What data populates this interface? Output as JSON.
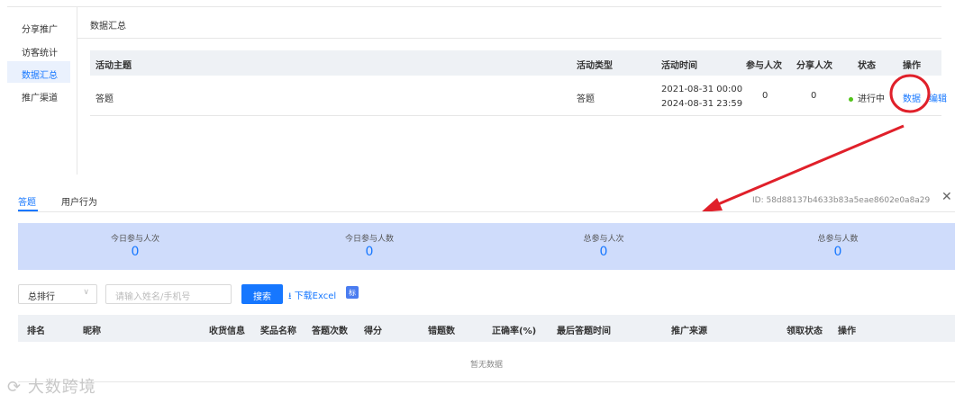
{
  "sidebar": {
    "items": [
      {
        "label": "分享推广"
      },
      {
        "label": "访客统计"
      },
      {
        "label": "数据汇总"
      },
      {
        "label": "推广渠道"
      }
    ]
  },
  "header": {
    "title": "数据汇总"
  },
  "activity_table": {
    "columns": [
      "活动主题",
      "活动类型",
      "活动时间",
      "参与人次",
      "分享人次",
      "状态",
      "操作"
    ],
    "rows": [
      {
        "subject": "答题",
        "type": "答题",
        "time_start": "2021-08-31 00:00",
        "time_end": "2024-08-31 23:59",
        "participants": "0",
        "shares": "0",
        "status": "进行中",
        "action_data": "数据",
        "action_edit": "编辑"
      }
    ]
  },
  "detail": {
    "tabs": [
      {
        "label": "答题"
      },
      {
        "label": "用户行为"
      }
    ],
    "id_text": "ID:  58d88137b4633b83a5eae8602e0a8a29",
    "close_icon": "close-icon",
    "stats": [
      {
        "label": "今日参与人次",
        "value": "0"
      },
      {
        "label": "今日参与人数",
        "value": "0"
      },
      {
        "label": "总参与人次",
        "value": "0"
      },
      {
        "label": "总参与人数",
        "value": "0"
      }
    ],
    "filter": {
      "select_value": "总排行",
      "search_placeholder": "请输入姓名/手机号",
      "search_label": "搜索",
      "download_label": "下载Excel",
      "badge": "标"
    },
    "rank_table": {
      "columns": [
        "排名",
        "昵称",
        "收货信息",
        "奖品名称",
        "答题次数",
        "得分",
        "错题数",
        "正确率(%)",
        "最后答题时间",
        "推广来源",
        "领取状态",
        "操作"
      ],
      "empty_text": "暂无数据"
    }
  },
  "watermark": "大数跨境",
  "colors": {
    "accent": "#1677ff",
    "annotation": "#e0202a",
    "stats_bg": "#cfdcfb"
  }
}
